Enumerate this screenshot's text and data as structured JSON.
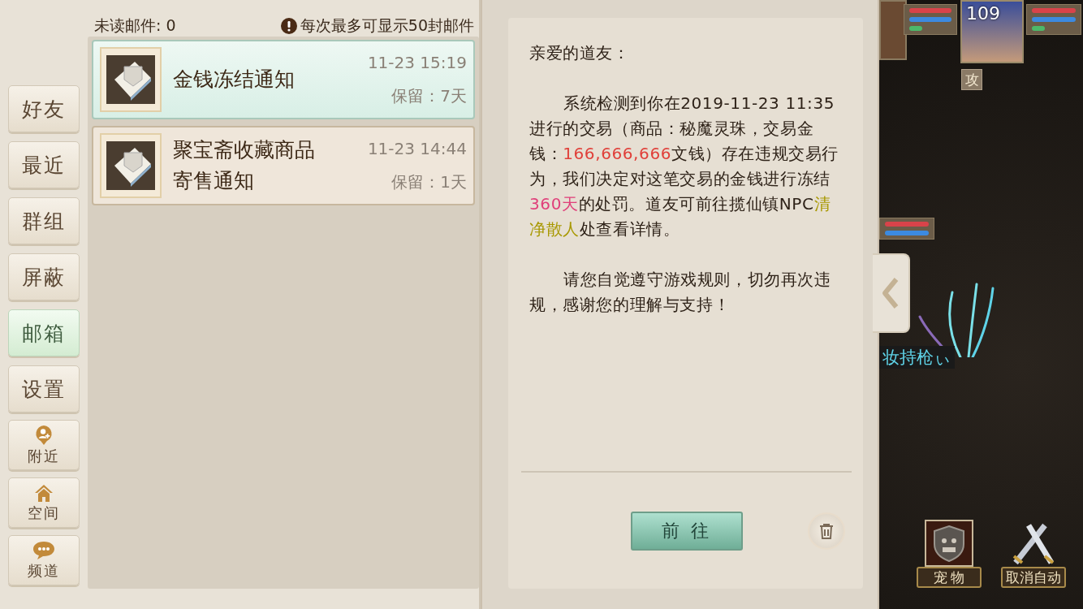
{
  "sidebar": {
    "items": [
      {
        "label": "好友",
        "kind": "plain",
        "selected": false
      },
      {
        "label": "最近",
        "kind": "plain",
        "selected": false
      },
      {
        "label": "群组",
        "kind": "plain",
        "selected": false
      },
      {
        "label": "屏蔽",
        "kind": "plain",
        "selected": false
      },
      {
        "label": "邮箱",
        "kind": "plain",
        "selected": true
      },
      {
        "label": "设置",
        "kind": "plain",
        "selected": false
      },
      {
        "label": "附近",
        "kind": "pin",
        "selected": false
      },
      {
        "label": "空间",
        "kind": "house",
        "selected": false
      },
      {
        "label": "频道",
        "kind": "bubble",
        "selected": false
      }
    ]
  },
  "mail_list": {
    "unread_label": "未读邮件: 0",
    "notice": "每次最多可显示50封邮件",
    "items": [
      {
        "title": "金钱冻结通知",
        "time": "11-23 15:19",
        "keep": "保留：7天",
        "selected": true
      },
      {
        "title": "聚宝斋收藏商品寄售通知",
        "time": "11-23 14:44",
        "keep": "保留：1天",
        "selected": false
      }
    ]
  },
  "mail_detail": {
    "paragraphs": [
      {
        "kind": "greeting",
        "segments": [
          {
            "text": "亲爱的道友："
          }
        ]
      },
      {
        "kind": "body",
        "segments": [
          {
            "text": "系统检测到你在2019-11-23 11:35进行的交易（商品：秘魔灵珠，交易金钱："
          },
          {
            "text": "166,666,666",
            "color": "#e0403a"
          },
          {
            "text": "文钱）存在违规交易行为，我们决定对这笔交易的金钱进行冻结"
          },
          {
            "text": "360天",
            "color": "#e0407a"
          },
          {
            "text": "的处罚。道友可前往揽仙镇NPC"
          },
          {
            "text": "清净散人",
            "color": "#a89800"
          },
          {
            "text": "处查看详情。"
          }
        ]
      },
      {
        "kind": "body",
        "segments": [
          {
            "text": "请您自觉遵守游戏规则，切勿再次违规，感谢您的理解与支持！"
          }
        ]
      }
    ],
    "go_button": "前 往"
  },
  "game": {
    "player_level": "109",
    "attack_badge": "攻",
    "npc_name": "妆持枪ぃ",
    "skills": [
      {
        "label": "宠 物",
        "kind": "pet"
      },
      {
        "label": "取消自动",
        "kind": "auto"
      }
    ]
  }
}
